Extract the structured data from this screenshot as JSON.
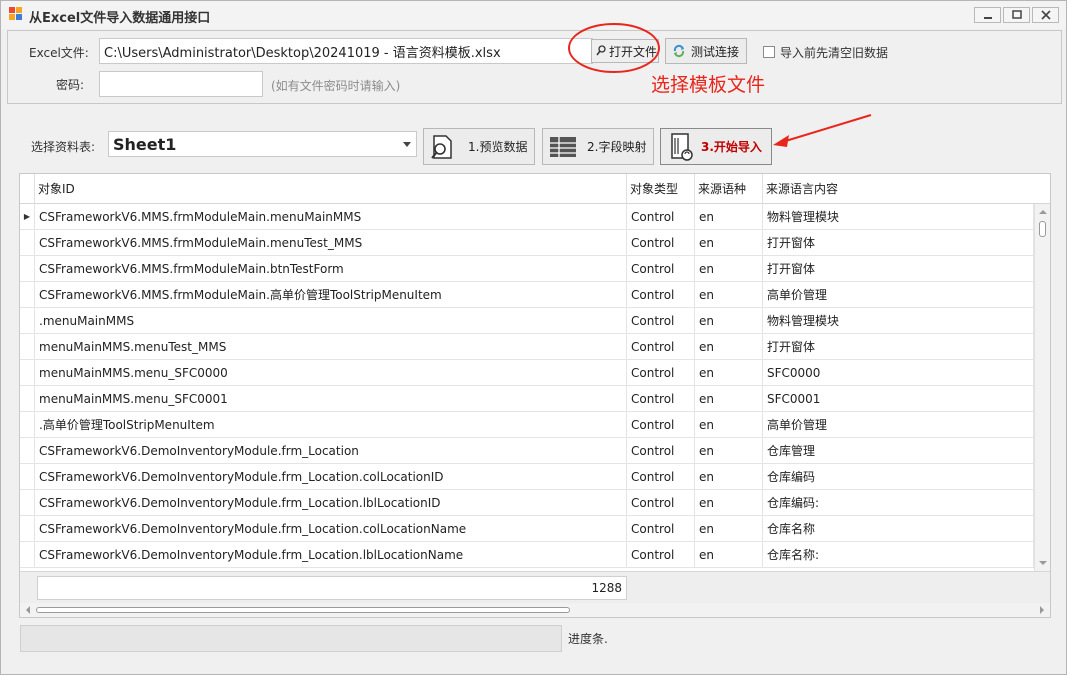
{
  "window": {
    "title": "从Excel文件导入数据通用接口",
    "controls": [
      "minimize",
      "maximize",
      "close"
    ]
  },
  "file_section": {
    "excel_label": "Excel文件:",
    "excel_path": "C:\\Users\\Administrator\\Desktop\\20241019 - 语言资料模板.xlsx",
    "open_button": "打开文件",
    "test_button": "测试连接",
    "clear_checkbox_label": "导入前先清空旧数据",
    "clear_checkbox_checked": false,
    "password_label": "密码:",
    "password_value": "",
    "password_hint": "(如有文件密码时请输入)"
  },
  "annotation": {
    "text": "选择模板文件",
    "color": "#e8261c"
  },
  "sheet_section": {
    "label": "选择资料表:",
    "selected_sheet": "Sheet1",
    "preview_button": "1.预览数据",
    "mapping_button": "2.字段映射",
    "import_button": "3.开始导入"
  },
  "grid": {
    "columns": [
      "对象ID",
      "对象类型",
      "来源语种",
      "来源语言内容"
    ],
    "rows": [
      [
        "CSFrameworkV6.MMS.frmModuleMain.menuMainMMS",
        "Control",
        "en",
        "物料管理模块"
      ],
      [
        "CSFrameworkV6.MMS.frmModuleMain.menuTest_MMS",
        "Control",
        "en",
        "打开窗体"
      ],
      [
        "CSFrameworkV6.MMS.frmModuleMain.btnTestForm",
        "Control",
        "en",
        "打开窗体"
      ],
      [
        "CSFrameworkV6.MMS.frmModuleMain.高单价管理ToolStripMenuItem",
        "Control",
        "en",
        "高单价管理"
      ],
      [
        ".menuMainMMS",
        "Control",
        "en",
        "物料管理模块"
      ],
      [
        "menuMainMMS.menuTest_MMS",
        "Control",
        "en",
        "打开窗体"
      ],
      [
        "menuMainMMS.menu_SFC0000",
        "Control",
        "en",
        "SFC0000"
      ],
      [
        "menuMainMMS.menu_SFC0001",
        "Control",
        "en",
        "SFC0001"
      ],
      [
        ".高单价管理ToolStripMenuItem",
        "Control",
        "en",
        "高单价管理"
      ],
      [
        "CSFrameworkV6.DemoInventoryModule.frm_Location",
        "Control",
        "en",
        "仓库管理"
      ],
      [
        "CSFrameworkV6.DemoInventoryModule.frm_Location.colLocationID",
        "Control",
        "en",
        "仓库编码"
      ],
      [
        "CSFrameworkV6.DemoInventoryModule.frm_Location.lblLocationID",
        "Control",
        "en",
        "仓库编码:"
      ],
      [
        "CSFrameworkV6.DemoInventoryModule.frm_Location.colLocationName",
        "Control",
        "en",
        "仓库名称"
      ],
      [
        "CSFrameworkV6.DemoInventoryModule.frm_Location.lblLocationName",
        "Control",
        "en",
        "仓库名称:"
      ]
    ],
    "record_count": "1288"
  },
  "progress": {
    "label": "进度条.",
    "value": 0
  }
}
